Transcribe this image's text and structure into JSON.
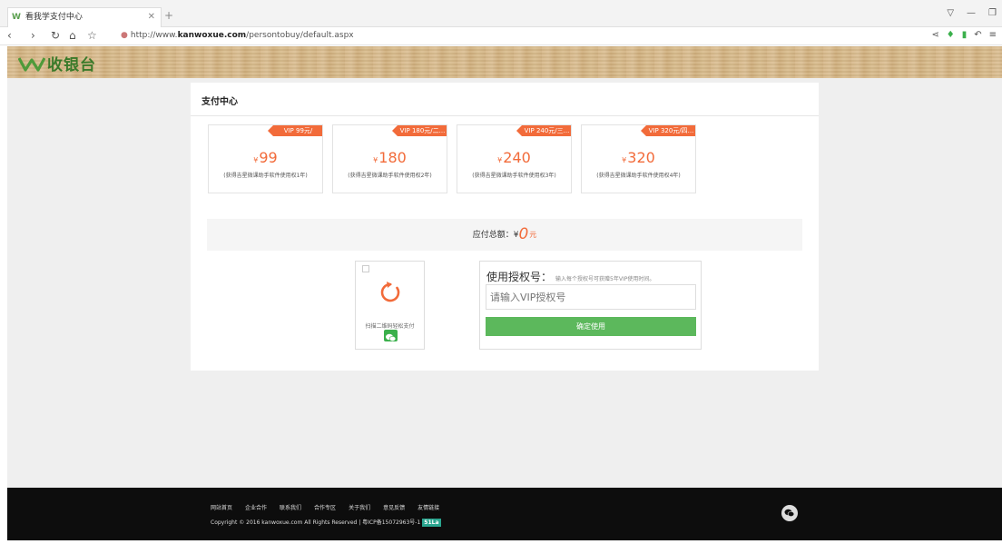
{
  "browser": {
    "tab_title": "看我学支付中心",
    "tab_favicon": "W",
    "url_prefix": "http://www.",
    "url_domain": "kanwoxue.com",
    "url_path": "/persontobuy/default.aspx"
  },
  "header": {
    "logo_text": "收银台"
  },
  "card": {
    "title": "支付中心"
  },
  "plans": [
    {
      "tag": "VIP 99元/",
      "currency": "¥",
      "price": "99",
      "desc": "(获得吉星微课助手软件使用权1年)"
    },
    {
      "tag": "VIP 180元/二...",
      "currency": "¥",
      "price": "180",
      "desc": "(获得吉星微课助手软件使用权2年)"
    },
    {
      "tag": "VIP 240元/三...",
      "currency": "¥",
      "price": "240",
      "desc": "(获得吉星微课助手软件使用权3年)"
    },
    {
      "tag": "VIP 320元/四...",
      "currency": "¥",
      "price": "320",
      "desc": "(获得吉星微课助手软件使用权4年)"
    }
  ],
  "total": {
    "label": "应付总额：¥",
    "amount": "0",
    "unit": "元"
  },
  "qr": {
    "hint": "扫描二维码轻松支付"
  },
  "auth": {
    "title": "使用授权号：",
    "subtitle": "输入每个授权号可获赠5年VIP使用时间。",
    "placeholder": "请输入VIP授权号",
    "button": "确定使用"
  },
  "footer": {
    "links": [
      "网站首页",
      "企业合作",
      "联系我们",
      "合作专区",
      "关于我们",
      "意见反馈",
      "友情链接"
    ],
    "copyright": "Copyright © 2016 kanwoxue.com All Rights Reserved | 粤ICP备15072963号-1",
    "badge": "51La"
  },
  "colors": {
    "accent": "#f26b3a",
    "confirm": "#5cb85c",
    "brand_green": "#3a7a2a"
  }
}
